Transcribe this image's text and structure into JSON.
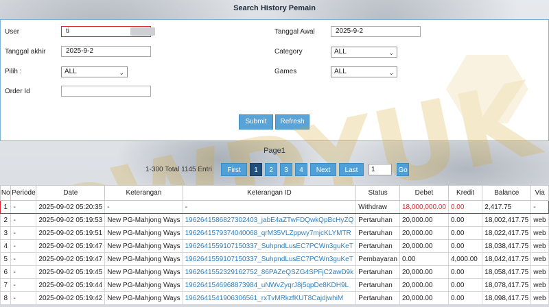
{
  "header": {
    "title": "Search History Pemain"
  },
  "form": {
    "user_label": "User",
    "user_value": "ti",
    "tanggal_akhir_label": "Tanggal akhir",
    "tanggal_akhir_value": "2025-9-2",
    "pilih_label": "Pilih :",
    "pilih_value": "ALL",
    "order_id_label": "Order Id",
    "order_id_value": "",
    "tanggal_awal_label": "Tanggal Awal",
    "tanggal_awal_value": "2025-9-2",
    "category_label": "Category",
    "category_value": "ALL",
    "games_label": "Games",
    "games_value": "ALL",
    "submit_label": "Submit",
    "refresh_label": "Refresh"
  },
  "pager": {
    "page_title": "Page1",
    "total_text": "1-300 Total 1145 Entri",
    "first_label": "First",
    "pages": [
      "1",
      "2",
      "3",
      "4"
    ],
    "next_label": "Next",
    "last_label": "Last",
    "jump_value": "1",
    "go_label": "Go"
  },
  "table": {
    "columns": [
      "No",
      "Periode",
      "Date",
      "Keterangan",
      "Keterangan ID",
      "Status",
      "Debet",
      "Kredit",
      "Balance",
      "Via"
    ],
    "rows": [
      [
        "1",
        "-",
        "2025-09-02 05:20:35",
        "-",
        "-",
        "Withdraw",
        "18,000,000.00",
        "0.00",
        "2,417.75",
        "-"
      ],
      [
        "2",
        "-",
        "2025-09-02 05:19:53",
        "New PG-Mahjong Ways",
        "1962641586827302403_jabE4aZTwFDQwkQpBcHyZQ",
        "Pertaruhan",
        "20,000.00",
        "0.00",
        "18,002,417.75",
        "web"
      ],
      [
        "3",
        "-",
        "2025-09-02 05:19:51",
        "New PG-Mahjong Ways",
        "1962641579374040068_qrM35VLZppwy7mjcKLYMTR",
        "Pertaruhan",
        "20,000.00",
        "0.00",
        "18,022,417.75",
        "web"
      ],
      [
        "4",
        "-",
        "2025-09-02 05:19:47",
        "New PG-Mahjong Ways",
        "1962641559107150337_SuhpndLusEC7PCWn3guKeT",
        "Pertaruhan",
        "20,000.00",
        "0.00",
        "18,038,417.75",
        "web"
      ],
      [
        "5",
        "-",
        "2025-09-02 05:19:47",
        "New PG-Mahjong Ways",
        "1962641559107150337_SuhpndLusEC7PCWn3guKeT",
        "Pembayaran",
        "0.00",
        "4,000.00",
        "18,042,417.75",
        "web"
      ],
      [
        "6",
        "-",
        "2025-09-02 05:19:45",
        "New PG-Mahjong Ways",
        "1962641552329162752_86PAZeQSZG4SPFjC2awD9k",
        "Pertaruhan",
        "20,000.00",
        "0.00",
        "18,058,417.75",
        "web"
      ],
      [
        "7",
        "-",
        "2025-09-02 05:19:44",
        "New PG-Mahjong Ways",
        "1962641546968873984_uNWvZyqrJ8j5qpDe8KDH9L",
        "Pertaruhan",
        "20,000.00",
        "0.00",
        "18,078,417.75",
        "web"
      ],
      [
        "8",
        "-",
        "2025-09-02 05:19:42",
        "New PG-Mahjong Ways",
        "1962641541906306561_rxTvMRkzfKUT8CajdjwhiM",
        "Pertaruhan",
        "20,000.00",
        "0.00",
        "18,098,417.75",
        "web"
      ]
    ]
  },
  "watermark": {
    "text": "WDYUK"
  },
  "colors": {
    "accent": "#4fa0d8",
    "active_page": "#1f4f7a",
    "highlight": "#d9232d",
    "link": "#2f7fc1"
  }
}
